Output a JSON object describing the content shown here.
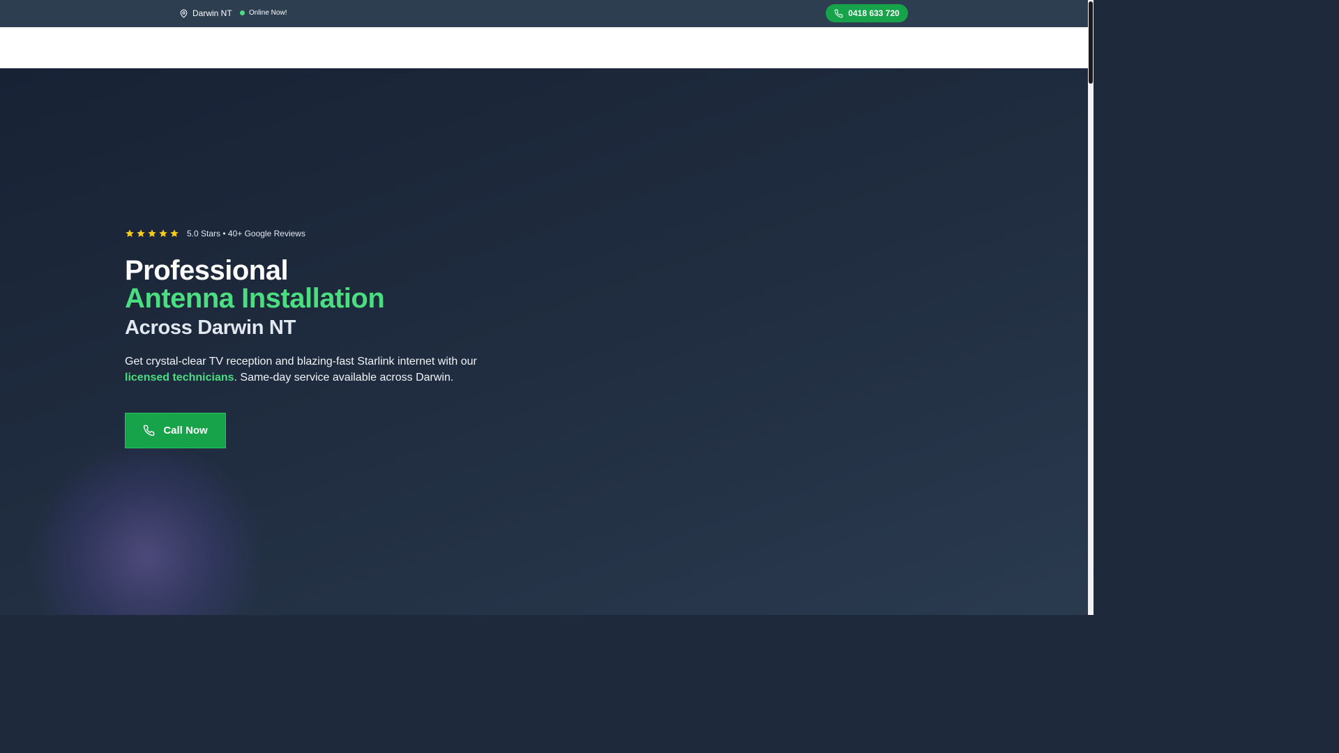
{
  "topbar": {
    "location": "Darwin NT",
    "location_icon": "map-pin-icon",
    "status": "Online Now!",
    "phone": "0418 633 720",
    "phone_icon": "phone-icon"
  },
  "hero": {
    "rating_text": "5.0 Stars • 40+ Google Reviews",
    "star_count": 5,
    "heading_line1": "Professional",
    "heading_line2": "Antenna Installation",
    "heading_line3": "Across Darwin NT",
    "description_part1": "Get crystal-clear TV reception and blazing-fast Starlink internet with our ",
    "description_highlight": "licensed technicians",
    "description_part2": ". Same-day service available across Darwin.",
    "cta_label": "Call Now"
  },
  "colors": {
    "accent_green": "#4ade80",
    "button_green": "#16a34a",
    "topbar_bg": "#2c3e50",
    "star_gold": "#facc15"
  }
}
